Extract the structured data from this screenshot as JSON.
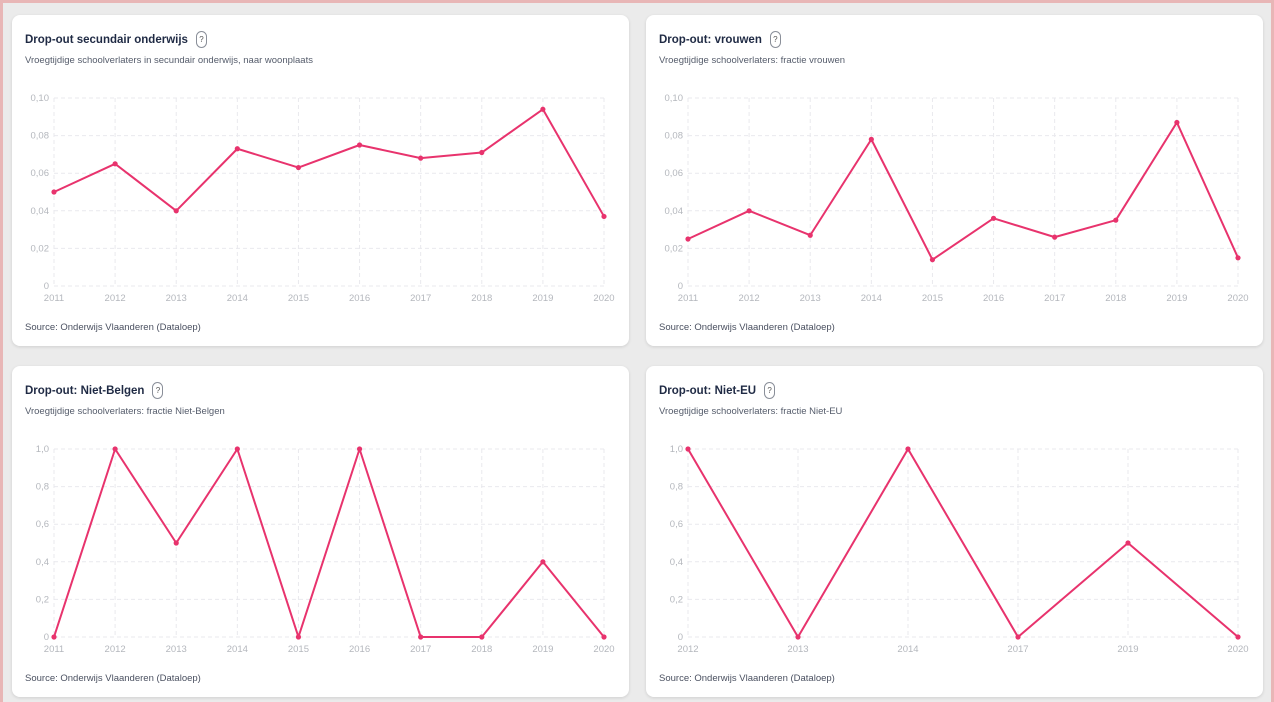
{
  "colors": {
    "line": "#e8336d",
    "grid": "#e9e9ee",
    "tick": "#b4b7bd"
  },
  "icons": {
    "help": "question-mark-icon"
  },
  "cards": [
    {
      "title": "Drop-out secundair onderwijs",
      "help": "?",
      "subtitle": "Vroegtijdige schoolverlaters in secundair onderwijs, naar woonplaats",
      "source": "Source: Onderwijs Vlaanderen (Dataloep)"
    },
    {
      "title": "Drop-out: vrouwen",
      "help": "?",
      "subtitle": "Vroegtijdige schoolverlaters: fractie vrouwen",
      "source": "Source: Onderwijs Vlaanderen (Dataloep)"
    },
    {
      "title": "Drop-out: Niet-Belgen",
      "help": "?",
      "subtitle": "Vroegtijdige schoolverlaters: fractie Niet-Belgen",
      "source": "Source: Onderwijs Vlaanderen (Dataloep)"
    },
    {
      "title": "Drop-out: Niet-EU",
      "help": "?",
      "subtitle": "Vroegtijdige schoolverlaters: fractie Niet-EU",
      "source": "Source: Onderwijs Vlaanderen (Dataloep)"
    }
  ],
  "chart_data": [
    {
      "type": "line",
      "x": [
        "2011",
        "2012",
        "2013",
        "2014",
        "2015",
        "2016",
        "2017",
        "2018",
        "2019",
        "2020"
      ],
      "values": [
        0.05,
        0.065,
        0.04,
        0.073,
        0.063,
        0.075,
        0.068,
        0.071,
        0.094,
        0.037
      ],
      "ylim": [
        0,
        0.1
      ],
      "yticks": [
        "0",
        "0,02",
        "0,04",
        "0,06",
        "0,08",
        "0,10"
      ],
      "grid": true
    },
    {
      "type": "line",
      "x": [
        "2011",
        "2012",
        "2013",
        "2014",
        "2015",
        "2016",
        "2017",
        "2018",
        "2019",
        "2020"
      ],
      "values": [
        0.025,
        0.04,
        0.027,
        0.078,
        0.014,
        0.036,
        0.026,
        0.035,
        0.087,
        0.015
      ],
      "ylim": [
        0,
        0.1
      ],
      "yticks": [
        "0",
        "0,02",
        "0,04",
        "0,06",
        "0,08",
        "0,10"
      ],
      "grid": true
    },
    {
      "type": "line",
      "x": [
        "2011",
        "2012",
        "2013",
        "2014",
        "2015",
        "2016",
        "2017",
        "2018",
        "2019",
        "2020"
      ],
      "values": [
        0,
        1.0,
        0.5,
        1.0,
        0,
        1.0,
        0,
        0,
        0.4,
        0
      ],
      "ylim": [
        0,
        1.0
      ],
      "yticks": [
        "0",
        "0,2",
        "0,4",
        "0,6",
        "0,8",
        "1,0"
      ],
      "grid": true
    },
    {
      "type": "line",
      "x": [
        "2012",
        "2013",
        "2014",
        "2017",
        "2019",
        "2020"
      ],
      "values": [
        1.0,
        0,
        1.0,
        0,
        0.5,
        0
      ],
      "ylim": [
        0,
        1.0
      ],
      "yticks": [
        "0",
        "0,2",
        "0,4",
        "0,6",
        "0,8",
        "1,0"
      ],
      "grid": true
    }
  ]
}
